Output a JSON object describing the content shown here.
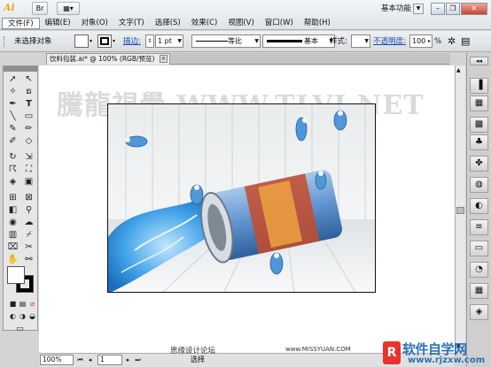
{
  "app": {
    "logo": "Ai",
    "workspace": "基本功能"
  },
  "menu": [
    "文件(F)",
    "编辑(E)",
    "对象(O)",
    "文字(T)",
    "选择(S)",
    "效果(C)",
    "视图(V)",
    "窗口(W)",
    "帮助(H)"
  ],
  "controlbar": {
    "selection": "未选择对象",
    "stroke_link": "描边:",
    "stroke_weight": "1 pt",
    "profile": "等比",
    "brush": "基本",
    "style_label": "样式:",
    "opacity_link": "不透明度:",
    "opacity_value": "100",
    "percent": "%"
  },
  "document": {
    "tab": "饮料包装.ai* @ 100% (RGB/预览)",
    "close": "×"
  },
  "watermark": "騰龍視覺 WWW.TLVI.NET",
  "status": {
    "zoom": "100%",
    "page": "1",
    "tool": "选择",
    "site": "思缘设计论坛",
    "site_url": "www.MISSYUAN.COM"
  },
  "brand": {
    "mark": "R",
    "name": "软件自学网",
    "url": "www.rjzxw.com"
  },
  "colors": {
    "brand_blue": "#2d72b8",
    "brand_red": "#e7332a",
    "ai_orange": "#f7a21b",
    "link_blue": "#1a4fb4"
  }
}
